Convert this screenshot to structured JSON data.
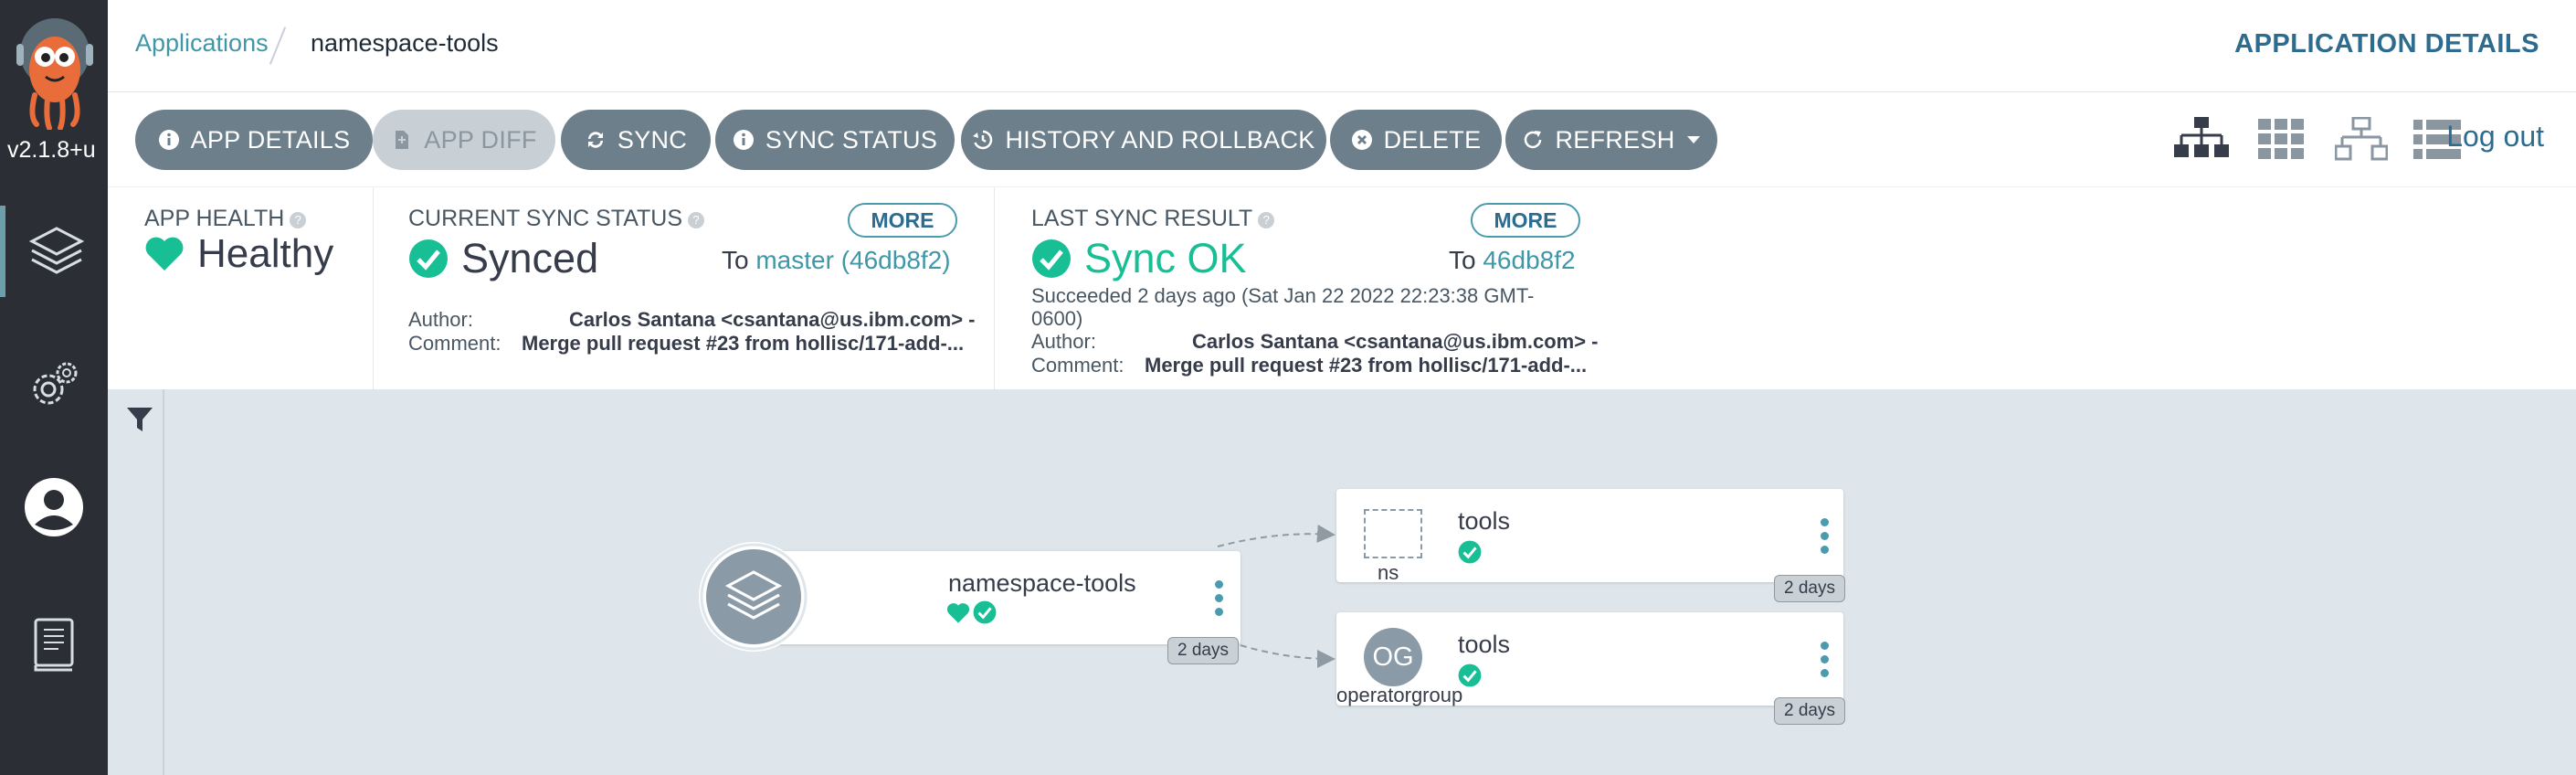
{
  "sidebar": {
    "version": "v2.1.8+u",
    "nav": [
      {
        "name": "applications",
        "icon": "layers-icon"
      },
      {
        "name": "settings",
        "icon": "gear-icon"
      },
      {
        "name": "user-info",
        "icon": "user-icon"
      },
      {
        "name": "documentation",
        "icon": "book-icon"
      }
    ]
  },
  "breadcrumb": {
    "parent": "Applications",
    "current": "namespace-tools"
  },
  "page_heading": "APPLICATION DETAILS",
  "toolbar": {
    "app_details": "APP DETAILS",
    "app_diff": "APP DIFF",
    "sync": "SYNC",
    "sync_status": "SYNC STATUS",
    "history": "HISTORY AND ROLLBACK",
    "delete": "DELETE",
    "refresh": "REFRESH",
    "logout": "Log out"
  },
  "status": {
    "health_label": "APP HEALTH",
    "health_value": "Healthy",
    "sync_label": "CURRENT SYNC STATUS",
    "sync_value": "Synced",
    "sync_more": "MORE",
    "sync_to_prefix": "To",
    "sync_to_target": "master (46db8f2)",
    "sync_author_label": "Author:",
    "sync_author": "Carlos Santana <csantana@us.ibm.com> -",
    "sync_comment_label": "Comment:",
    "sync_comment": "Merge pull request #23 from hollisc/171-add-...",
    "last_label": "LAST SYNC RESULT",
    "last_value": "Sync OK",
    "last_more": "MORE",
    "last_to_prefix": "To",
    "last_to_target": "46db8f2",
    "last_succeeded": "Succeeded 2 days ago (Sat Jan 22 2022 22:23:38 GMT-",
    "last_succeeded_2": "0600)",
    "last_author_label": "Author:",
    "last_author": "Carlos Santana <csantana@us.ibm.com> -",
    "last_comment_label": "Comment:",
    "last_comment": "Merge pull request #23 from hollisc/171-add-..."
  },
  "graph": {
    "app_node": {
      "title": "namespace-tools",
      "age": "2 days"
    },
    "nodes": [
      {
        "title": "tools",
        "kind": "ns",
        "age": "2 days"
      },
      {
        "title": "tools",
        "kind": "operatorgroup",
        "badge": "OG",
        "age": "2 days"
      }
    ]
  },
  "colors": {
    "sidebar_bg": "#2b2f35",
    "accent": "#4097a8",
    "heading": "#2d6c8e",
    "healthy": "#18be94",
    "button": "#6d7f8b"
  }
}
